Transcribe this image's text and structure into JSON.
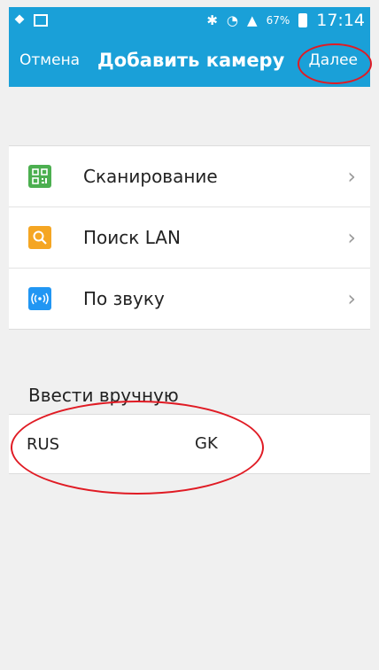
{
  "statusbar": {
    "battery_percent": "67%",
    "time": "17:14",
    "icons": [
      "usb-icon",
      "gallery-icon",
      "bluetooth-icon",
      "wifi-icon",
      "signal-icon",
      "battery-icon"
    ]
  },
  "header": {
    "cancel_label": "Отмена",
    "title": "Добавить камеру",
    "next_label": "Далее"
  },
  "menu": {
    "items": [
      {
        "label": "Сканирование",
        "icon": "qr-scan-icon",
        "color": "#4caf50"
      },
      {
        "label": "Поиск LAN",
        "icon": "search-icon",
        "color": "#f5a623"
      },
      {
        "label": "По звуку",
        "icon": "sound-wave-icon",
        "color": "#2196f3"
      }
    ]
  },
  "manual": {
    "section_title": "Ввести вручную",
    "input_value": "RUS",
    "extra_text": "GK"
  },
  "annotations": {
    "color": "#e01b24"
  }
}
